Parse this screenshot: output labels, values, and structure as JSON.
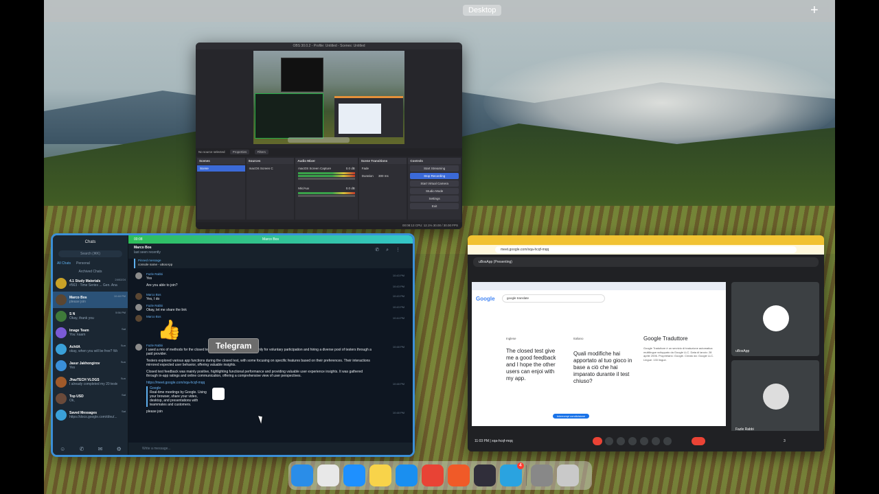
{
  "spaces": {
    "desktop_label": "Desktop",
    "add_space": "+"
  },
  "obs": {
    "title": "OBS 30.0.2 - Profile: Untitled - Scenes: Untitled",
    "no_source": "No source selected",
    "properties": "Properties",
    "filters": "Filters",
    "docks": {
      "scenes": {
        "header": "Scenes",
        "item": "Scene"
      },
      "sources": {
        "header": "Sources",
        "item": "macOS Screen C"
      },
      "mixer": {
        "header": "Audio Mixer",
        "ch1": "macOS Screen Capture",
        "ch1_db": "0.0 dB",
        "ch2": "Mic/Aux",
        "ch2_db": "0.0 dB"
      },
      "transitions": {
        "header": "Scene Transitions",
        "type": "Fade",
        "duration_label": "Duration",
        "duration": "300 ms"
      },
      "controls": {
        "header": "Controls",
        "start_streaming": "Start Streaming",
        "stop_recording": "Stop Recording",
        "virtual_camera": "Start Virtual Camera",
        "studio_mode": "Studio Mode",
        "settings": "Settings",
        "exit": "Exit"
      }
    },
    "status": "00:08:13    CPU: 12.1%    30.00 / 30.00 FPS"
  },
  "telegram": {
    "title": "Telegram",
    "sidebar": {
      "header": "Chats",
      "search_placeholder": "Search (⌘K)",
      "tab_all": "All Chats",
      "tab_personal": "Personal",
      "archived": "Archived Chats",
      "chats": [
        {
          "name": "4.1 Study Materials",
          "preview": "#563 · Time Series ... Gen. Analys...",
          "time": "24/02/24",
          "color": "#c9a227"
        },
        {
          "name": "Marco Bos",
          "preview": "please join",
          "time": "10:48 PM",
          "color": "#5a4632",
          "selected": true
        },
        {
          "name": "S N",
          "preview": "Okay, thank you",
          "time": "5:56 PM",
          "color": "#3f7a3a"
        },
        {
          "name": "Image Team",
          "preview": "You: kaam",
          "time": "Sat",
          "color": "#7a5ad6"
        },
        {
          "name": "AchilA",
          "preview": "okay, when you will be free? We will join a meet",
          "time": "Sun",
          "color": "#3aa0d8"
        },
        {
          "name": "Jasur Jakhongirov",
          "preview": "Yes",
          "time": "Sun",
          "color": "#3a8fd8"
        },
        {
          "name": "JhazTECH VLOGS",
          "preview": "I already completed my 20 tester for free thank you",
          "time": "Sun",
          "color": "#a05a2a"
        },
        {
          "name": "Top USD",
          "preview": "Ok,",
          "time": "Sat",
          "color": "#6a4a3a"
        },
        {
          "name": "Saved Messages",
          "preview": "https://docs.google.com/d/eu/...",
          "time": "Sat",
          "color": "#3aa0d8"
        }
      ]
    },
    "call": {
      "duration": "00:08",
      "name": "Marco Bos"
    },
    "chat_header": {
      "name": "Marco Bos",
      "status": "last seen recently"
    },
    "pinned": {
      "title": "Pinned message",
      "text": "console name - uBosApp"
    },
    "messages": [
      {
        "from": "Fazle Rabbi",
        "text": "Yes",
        "time": "10:43 PM"
      },
      {
        "from": "",
        "text": "Are you able to join?",
        "time": "10:43 PM"
      },
      {
        "from": "Marco Bos",
        "text": "Yes, I do",
        "time": "10:43 PM"
      },
      {
        "from": "Fazle Rabbi",
        "text": "Okay, let me share the link",
        "time": "10:43 PM"
      },
      {
        "from": "Marco Bos",
        "text": "",
        "time": "10:44 PM"
      },
      {
        "from": "Fazle Rabbi",
        "text": "I used a mix of methods for the closed test: reaching out to friends and family for voluntary participation and hiring a diverse pool of testers through a paid provider.",
        "time": "10:48 PM"
      },
      {
        "from": "",
        "text": "Testers explored various app functions during the closed test, with some focusing on specific features based on their preferences. Their interactions mirrored expected user behavior, offering valuable insights.",
        "time": ""
      },
      {
        "from": "",
        "text": "Closed test feedback was mainly positive, highlighting functional performance and providing valuable user experience insights. It was gathered through in-app ratings and online communication, offering a comprehensive view of user perspectives.",
        "time": ""
      }
    ],
    "thumbs": "👍",
    "link": "https://meet.google.com/xqa-hcqf-mqq",
    "link_preview": {
      "site": "Google",
      "text": "Real-time meetings by Google. Using your browser, share your video, desktop, and presentations with teammates and customers."
    },
    "link_time": "10:48 PM",
    "last_msg": "please join",
    "last_time": "10:48 PM",
    "input_placeholder": "Write a message...",
    "tooltip": "Telegram"
  },
  "chrome": {
    "tab_title": "Meet - xqa-hcqf-mqq",
    "url": "meet.google.com/xqa-hcqf-mqq",
    "presenting": "uBosApp (Presenting)",
    "google": {
      "logo": "Google",
      "query": "google translate",
      "src_lang": "Inglese",
      "dst_lang": "Italiano",
      "source_text": "The closed test give me a good feedback and I hope the other users can enjoi with my app.",
      "target_text": "Quali modifiche hai apportato al tuo gioco in base a ciò che hai imparato durante il test chiuso?",
      "kp_title": "Google Traduttore",
      "kp_text": "Google Traduttore è un servizio di traduzione automatica multilingue sviluppato da Google LLC. Data di lancio: 28 aprile 2006. Proprietario: Google. Creato da: Google LLC. Lingue: 133 lingue.",
      "restart": "Interrompi condivisione"
    },
    "tiles": [
      {
        "label": "uBosApp"
      },
      {
        "label": "Fazle Rabbi"
      }
    ],
    "meeting_info": "11:03 PM  |  xqa-hcqf-mqq",
    "participants_count": "3"
  },
  "dock": {
    "apps": [
      {
        "name": "finder",
        "color": "#2a8de8"
      },
      {
        "name": "launchpad",
        "color": "#e8e8e8"
      },
      {
        "name": "safari",
        "color": "#1e90ff"
      },
      {
        "name": "notes",
        "color": "#f8d34a"
      },
      {
        "name": "app-store",
        "color": "#1a8ff0"
      },
      {
        "name": "chrome",
        "color": "#e84335"
      },
      {
        "name": "brave",
        "color": "#f05a28"
      },
      {
        "name": "obs",
        "color": "#302e3a"
      },
      {
        "name": "telegram",
        "color": "#2aa3e0",
        "badge": "4"
      }
    ],
    "extras": [
      {
        "name": "downloads",
        "color": "#888"
      },
      {
        "name": "trash",
        "color": "#c9c9c9"
      }
    ]
  }
}
